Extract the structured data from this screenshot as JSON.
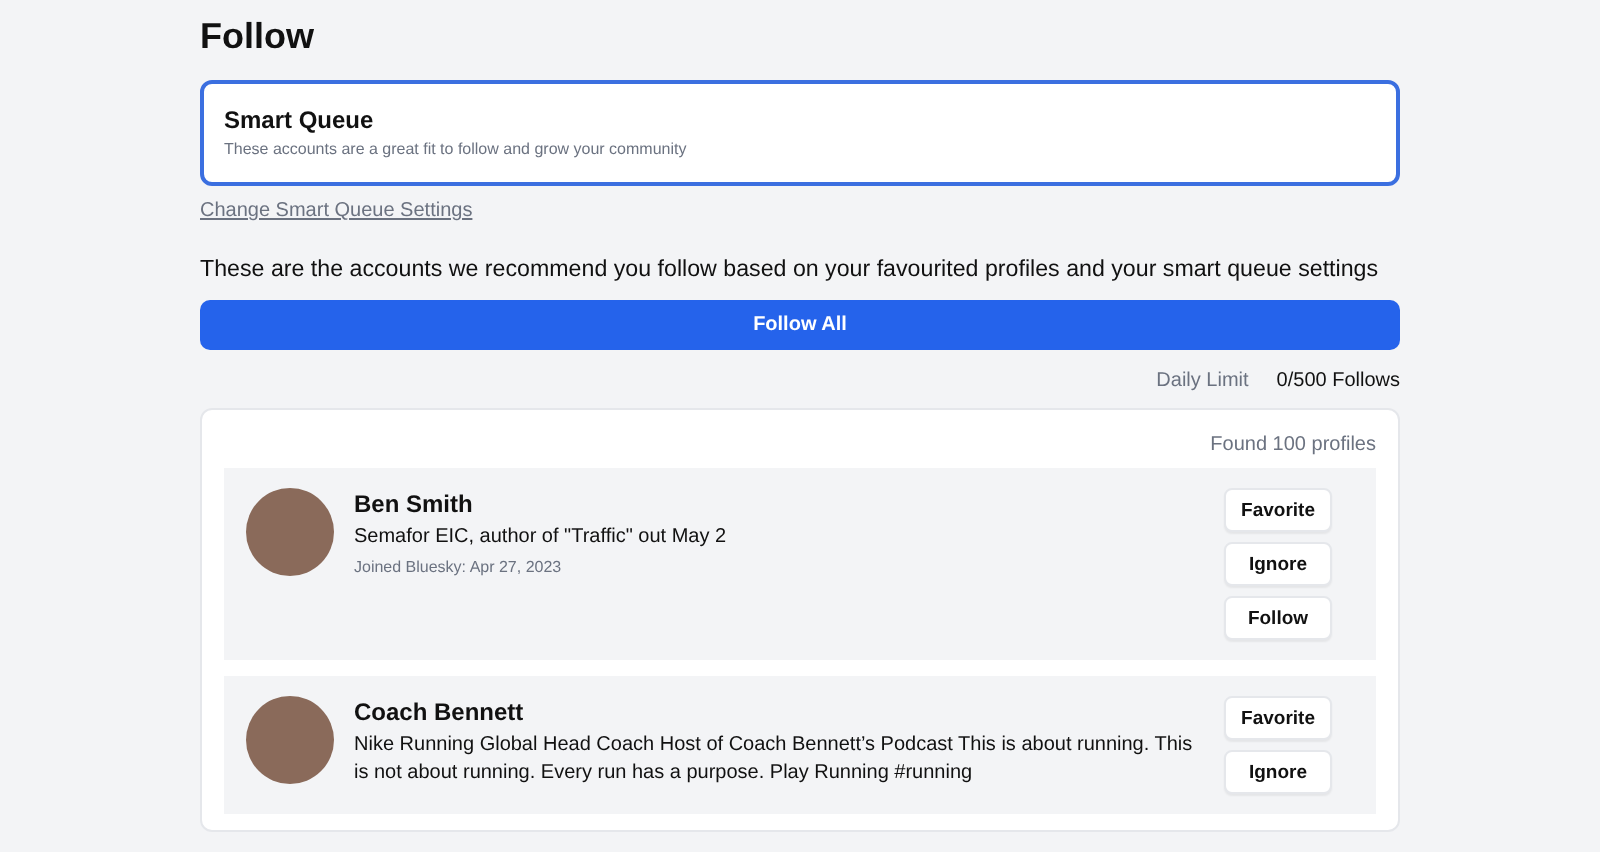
{
  "page_title": "Follow",
  "smart_queue": {
    "title": "Smart Queue",
    "description": "These accounts are a great fit to follow and grow your community"
  },
  "settings_link": "Change Smart Queue Settings",
  "intro": "These are the accounts we recommend you follow based on your favourited profiles and your smart queue settings",
  "follow_all_button": "Follow All",
  "daily_limit": {
    "label": "Daily Limit",
    "value": "0/500 Follows"
  },
  "found_count": "Found 100 profiles",
  "profiles": [
    {
      "name": "Ben Smith",
      "bio": "Semafor EIC, author of \"Traffic\" out May 2",
      "joined": "Joined Bluesky: Apr 27, 2023",
      "buttons": [
        "Favorite",
        "Ignore",
        "Follow"
      ]
    },
    {
      "name": "Coach Bennett",
      "bio": "Nike Running Global Head Coach Host of Coach Bennett’s Podcast This is about running. This is not about running. Every run has a purpose. Play Running #running",
      "buttons": [
        "Favorite",
        "Ignore"
      ]
    }
  ]
}
